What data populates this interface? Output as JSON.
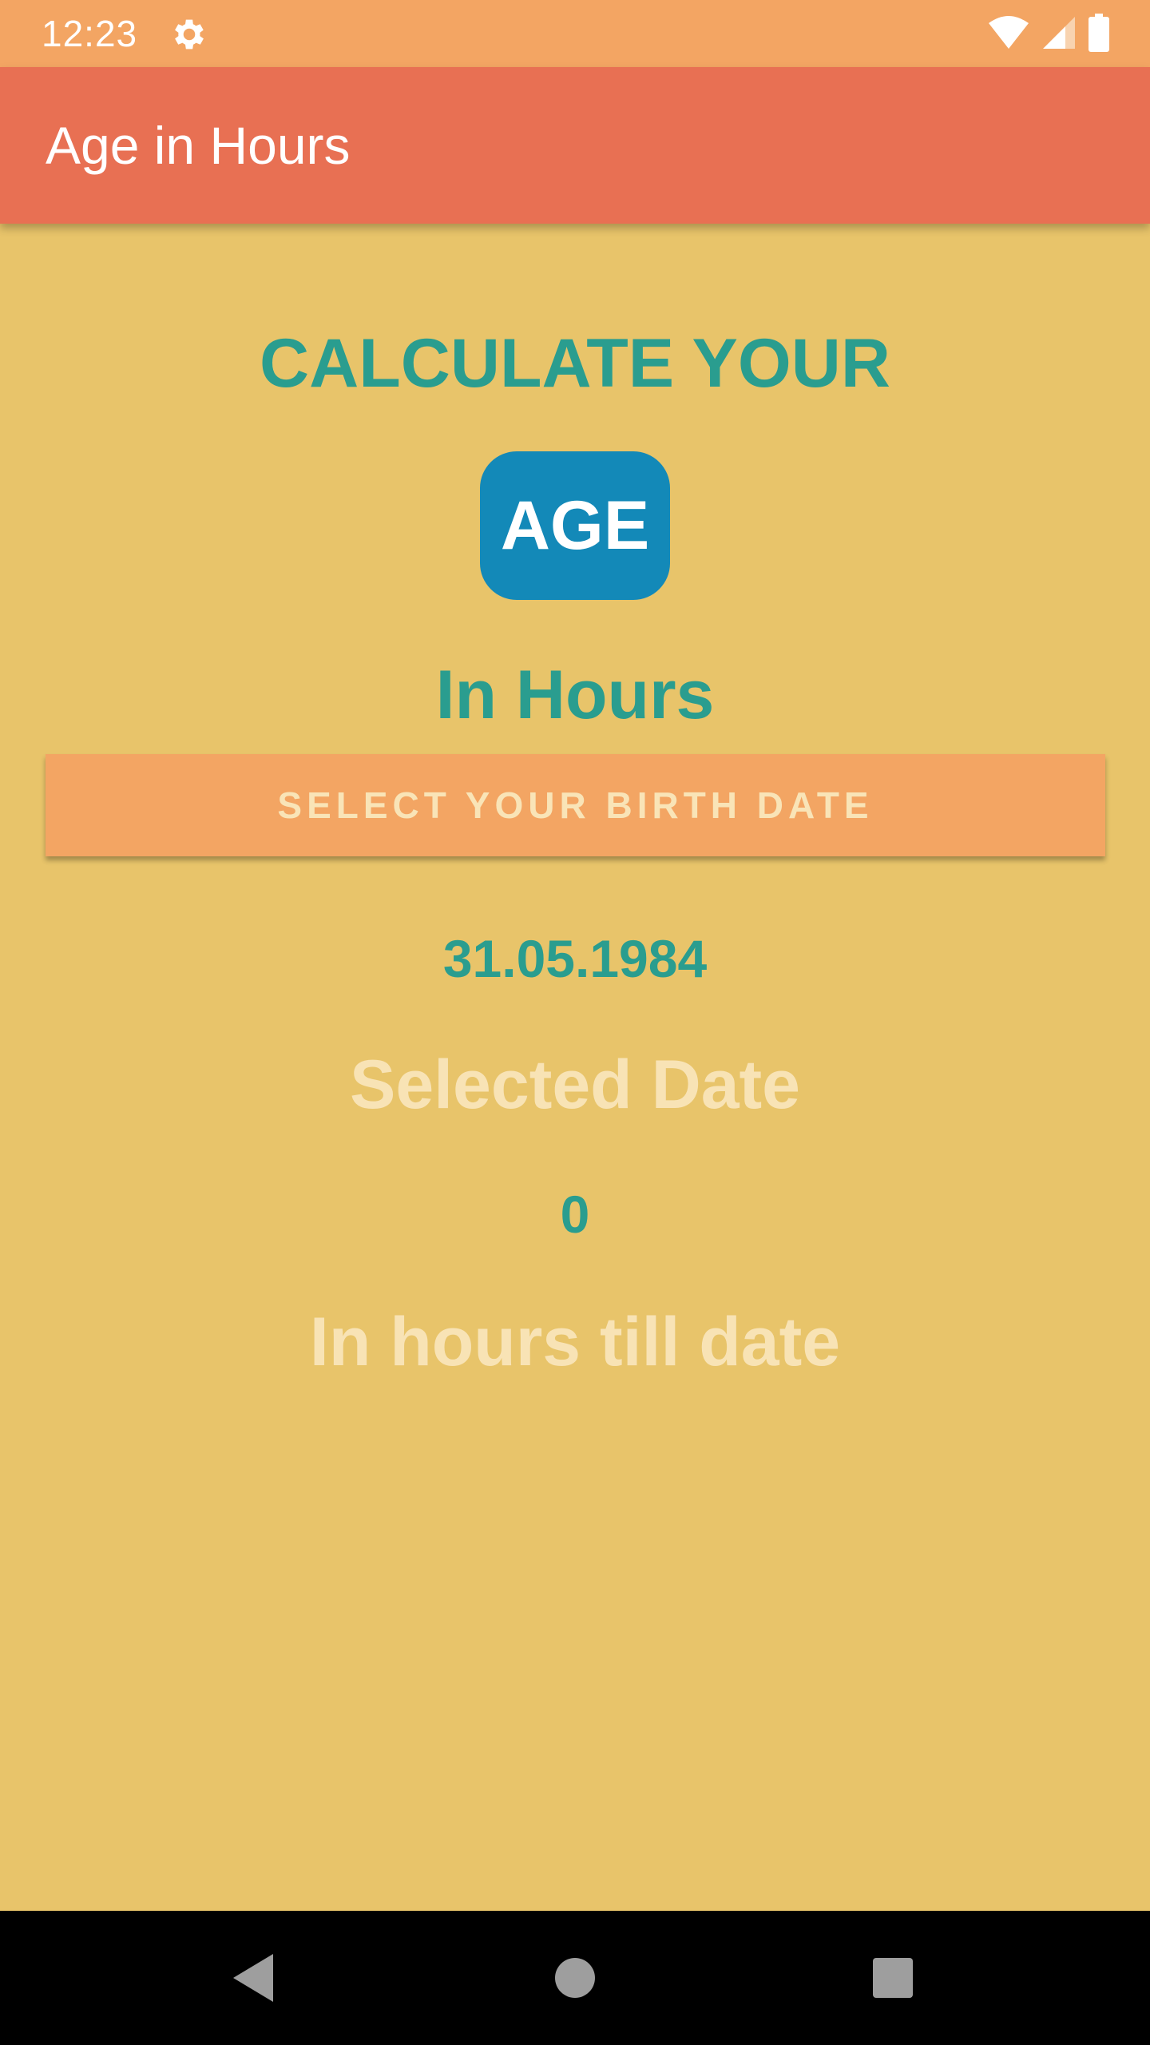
{
  "status_bar": {
    "time": "12:23",
    "icons": [
      "gear-icon",
      "wifi-icon",
      "signal-icon",
      "battery-icon"
    ]
  },
  "app_bar": {
    "title": "Age in Hours"
  },
  "main": {
    "headline": "CALCULATE YOUR",
    "badge": "AGE",
    "subheadline": "In Hours",
    "select_button_label": "SELECT YOUR BIRTH DATE",
    "selected_date_value": "31.05.1984",
    "selected_date_label": "Selected Date",
    "hours_value": "0",
    "hours_label": "In hours till date"
  },
  "nav_bar": {
    "icons": [
      "back-icon",
      "home-icon",
      "recents-icon"
    ]
  },
  "colors": {
    "background": "#E8C46A",
    "status_bar": "#F3A563",
    "app_bar": "#E87053",
    "accent_teal": "#2A9D8F",
    "badge_blue": "#1389B8",
    "muted_text": "#F8E3B5",
    "button": "#F3A563"
  }
}
